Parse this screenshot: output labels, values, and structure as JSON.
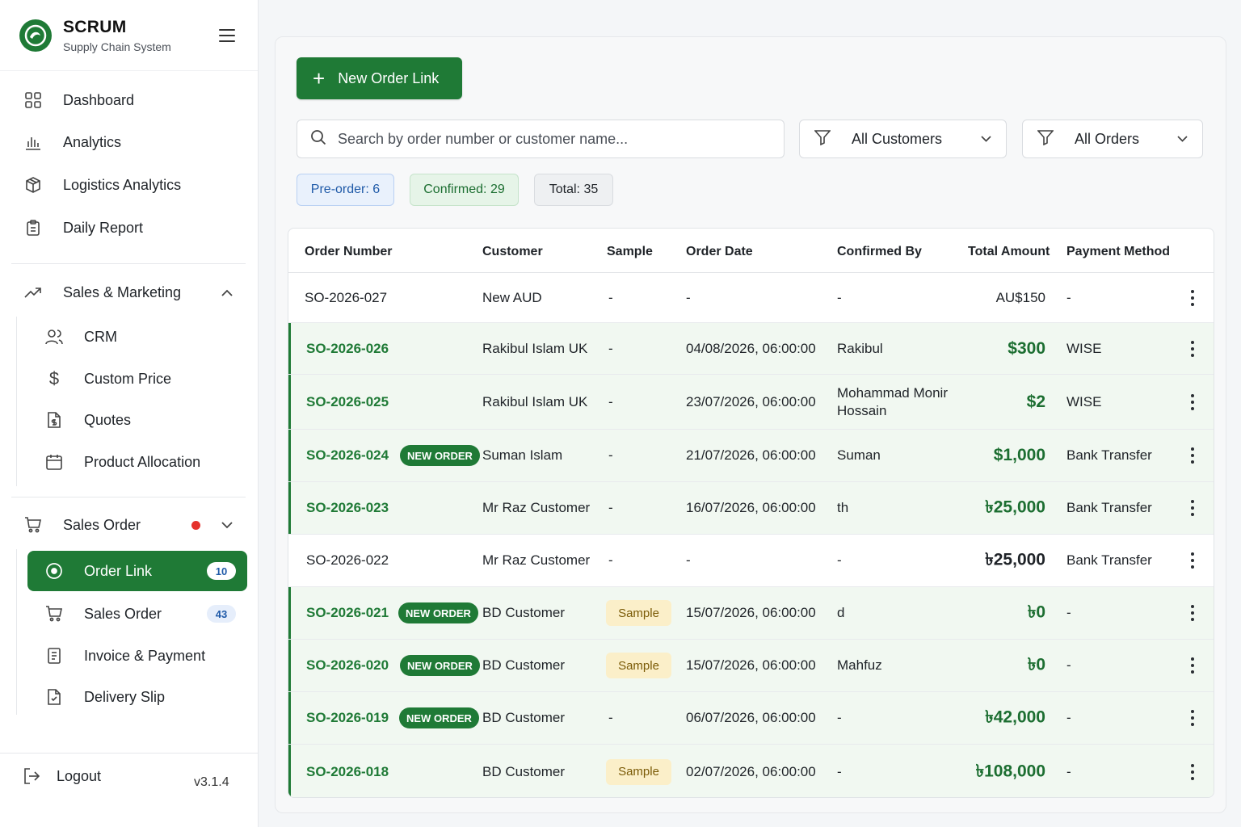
{
  "brand": {
    "name": "SCRUM",
    "subtitle": "Supply Chain System"
  },
  "nav": {
    "dashboard": "Dashboard",
    "analytics": "Analytics",
    "logistics": "Logistics Analytics",
    "daily": "Daily Report",
    "sales_marketing": "Sales & Marketing",
    "crm": "CRM",
    "custom_price": "Custom Price",
    "quotes": "Quotes",
    "product_allocation": "Product Allocation",
    "sales_order_group": "Sales Order",
    "order_link": "Order Link",
    "order_link_count": "10",
    "sales_order": "Sales Order",
    "sales_order_count": "43",
    "invoice": "Invoice & Payment",
    "delivery": "Delivery Slip"
  },
  "footer": {
    "logout": "Logout",
    "version": "v3.1.4"
  },
  "toolbar": {
    "new_button": "New Order Link",
    "search_placeholder": "Search by order number or customer name...",
    "customer_filter": "All Customers",
    "order_filter": "All Orders"
  },
  "stats": {
    "preorder_label": "Pre-order:",
    "preorder_value": "6",
    "confirmed_label": "Confirmed:",
    "confirmed_value": "29",
    "total_label": "Total:",
    "total_value": "35"
  },
  "table": {
    "headers": [
      "Order Number",
      "Customer",
      "Sample",
      "Order Date",
      "Confirmed By",
      "Total Amount",
      "Payment Method"
    ],
    "new_badge": "NEW ORDER",
    "sample_badge": "Sample",
    "rows": [
      {
        "order": "SO-2026-027",
        "customer": "New AUD",
        "sample": "-",
        "date": "-",
        "confirmed_by": "-",
        "amount": "AU$150",
        "payment": "-"
      },
      {
        "order": "SO-2026-026",
        "customer": "Rakibul Islam UK",
        "sample": "-",
        "date": "04/08/2026, 06:00:00",
        "confirmed_by": "Rakibul",
        "amount": "$300",
        "payment": "WISE"
      },
      {
        "order": "SO-2026-025",
        "customer": "Rakibul Islam UK",
        "sample": "-",
        "date": "23/07/2026, 06:00:00",
        "confirmed_by_1": "Mohammad Monir",
        "confirmed_by_2": "Hossain",
        "amount": "$2",
        "payment": "WISE"
      },
      {
        "order": "SO-2026-024",
        "customer": "Suman Islam",
        "sample": "-",
        "date": "21/07/2026, 06:00:00",
        "confirmed_by": "Suman",
        "amount": "$1,000",
        "payment": "Bank Transfer"
      },
      {
        "order": "SO-2026-023",
        "customer": "Mr Raz Customer",
        "sample": "-",
        "date": "16/07/2026, 06:00:00",
        "confirmed_by": "th",
        "amount": "৳25,000",
        "payment": "Bank Transfer"
      },
      {
        "order": "SO-2026-022",
        "customer": "Mr Raz Customer",
        "sample": "-",
        "date": "-",
        "confirmed_by": "-",
        "amount": "৳25,000",
        "payment": "Bank Transfer"
      },
      {
        "order": "SO-2026-021",
        "customer": "BD Customer",
        "date": "15/07/2026, 06:00:00",
        "confirmed_by": "d",
        "amount": "৳0",
        "payment": "-"
      },
      {
        "order": "SO-2026-020",
        "customer": "BD Customer",
        "date": "15/07/2026, 06:00:00",
        "confirmed_by": "Mahfuz",
        "amount": "৳0",
        "payment": "-"
      },
      {
        "order": "SO-2026-019",
        "customer": "BD Customer",
        "sample": "-",
        "date": "06/07/2026, 06:00:00",
        "confirmed_by": "-",
        "amount": "৳42,000",
        "payment": "-"
      },
      {
        "order": "SO-2026-018",
        "customer": "BD Customer",
        "date": "02/07/2026, 06:00:00",
        "confirmed_by": "-",
        "amount": "৳108,000",
        "payment": "-"
      }
    ]
  }
}
